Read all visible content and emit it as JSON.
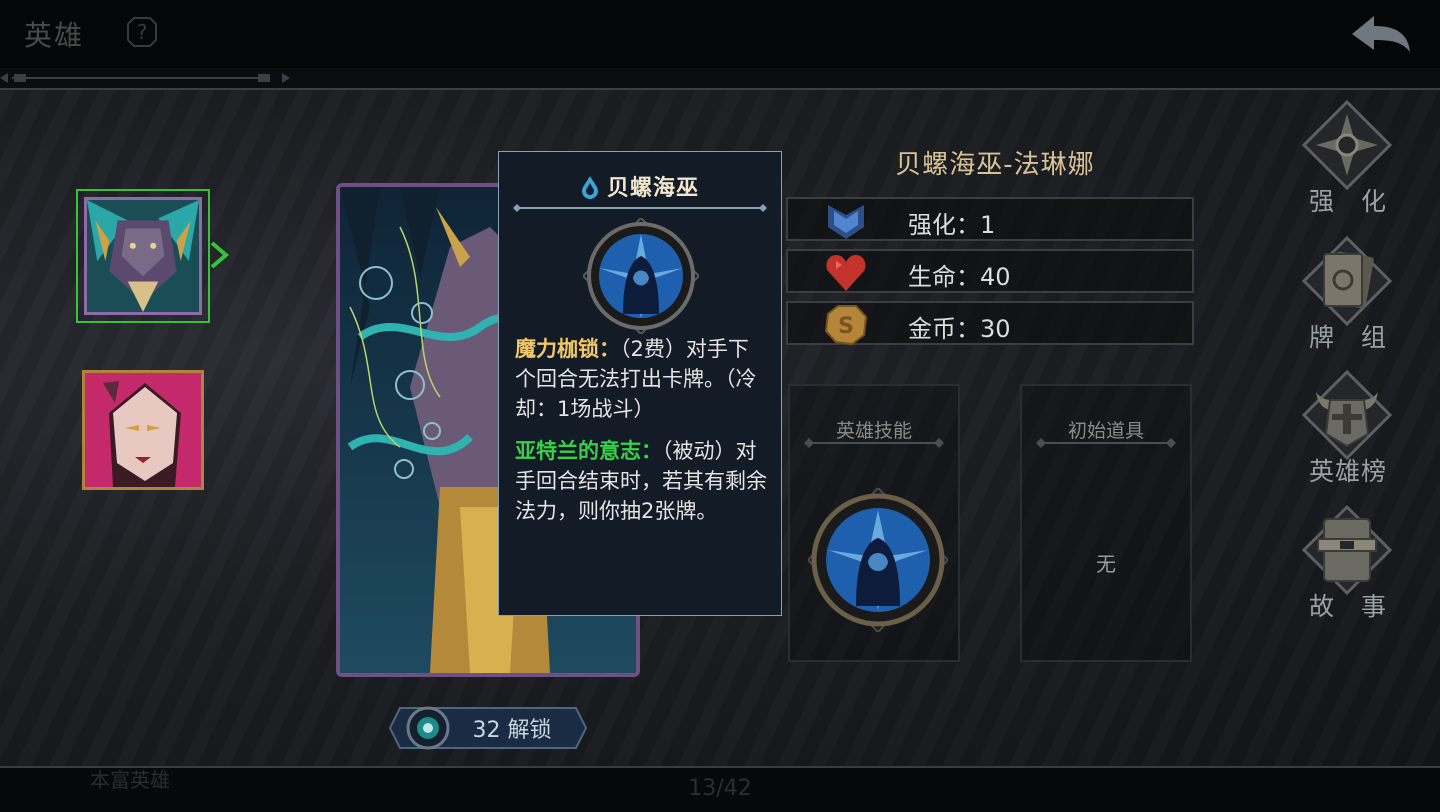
{
  "header": {
    "title": "英雄"
  },
  "heroes": [
    {
      "name": "贝螺海巫",
      "selected": true
    },
    {
      "name": "",
      "selected": false
    }
  ],
  "card": {
    "unlock_cost": "32",
    "unlock_label": "32 解锁"
  },
  "tooltip": {
    "title": "贝螺海巫",
    "ability1_name": "魔力枷锁：",
    "ability1_text": "（2费）对手下个回合无法打出卡牌。（冷却：1场战斗）",
    "ability2_name": "亚特兰的意志：",
    "ability2_text": "（被动）对手回合结束时，若其有剩余法力，则你抽2张牌。"
  },
  "hero_info": {
    "full_name": "贝螺海巫-法琳娜",
    "stats": [
      {
        "label": "强化：1",
        "icon": "rank-chevron-icon",
        "color": "#3f6fb0"
      },
      {
        "label": "生命：40",
        "icon": "heart-icon",
        "color": "#c4322c"
      },
      {
        "label": "金币：30",
        "icon": "coin-icon",
        "color": "#c89a45"
      }
    ],
    "skill_box_title": "英雄技能",
    "item_box_title": "初始道具",
    "item_box_empty": "无"
  },
  "menu": [
    {
      "label": "强　化",
      "icon": "compass-star-icon"
    },
    {
      "label": "牌　组",
      "icon": "card-deck-icon"
    },
    {
      "label": "英雄榜",
      "icon": "horned-helmet-icon"
    },
    {
      "label": "故　事",
      "icon": "book-icon"
    }
  ],
  "footer": {
    "page": "13/42",
    "hint": "本富英雄"
  },
  "colors": {
    "accent_gold": "#d7c396",
    "select_green": "#38c23a",
    "keyword_gold": "#f0c76a",
    "keyword_green": "#39d04a"
  }
}
